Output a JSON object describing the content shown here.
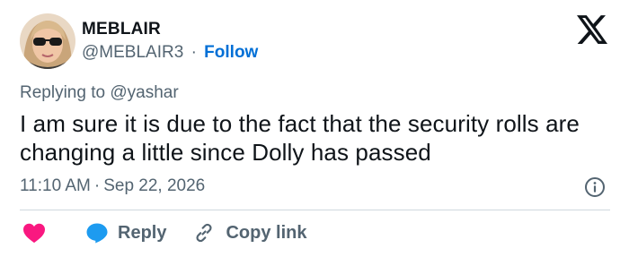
{
  "author": {
    "display_name": "MEBLAIR",
    "handle": "@MEBLAIR3",
    "separator": "·",
    "follow_label": "Follow"
  },
  "reply_context": {
    "prefix": "Replying to ",
    "mention": "@yashar"
  },
  "tweet": {
    "text": "I am sure it is due to the fact that the security rolls are changing a little since Dolly has passed",
    "time": "11:10 AM",
    "separator": "·",
    "date": "Sep 22, 2026"
  },
  "actions": {
    "reply_label": "Reply",
    "copy_link_label": "Copy link"
  },
  "icons": {
    "brand": "x-logo-icon",
    "info": "info-icon",
    "like": "heart-icon",
    "reply": "reply-bubble-icon",
    "copy": "link-icon"
  },
  "colors": {
    "link_blue": "#006fd6",
    "heart_pink": "#f91880",
    "reply_blue": "#1d9bf0",
    "muted_text": "#536471",
    "primary_text": "#0f1419",
    "divider": "#cfd9de"
  }
}
